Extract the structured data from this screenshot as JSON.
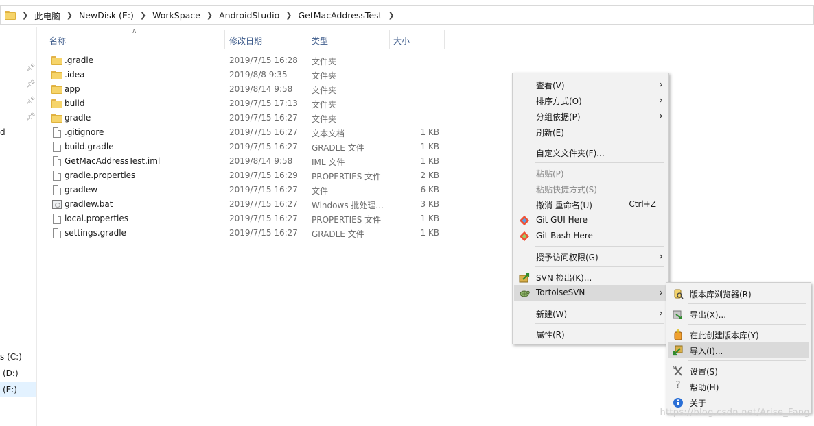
{
  "address_bar": {
    "crumbs": [
      "此电脑",
      "NewDisk (E:)",
      "WorkSpace",
      "AndroidStudio",
      "GetMacAddressTest"
    ]
  },
  "nav": {
    "partial_labels": [
      "d",
      "s (C:)",
      "(D:)",
      "(E:)"
    ]
  },
  "columns": {
    "name": "名称",
    "date": "修改日期",
    "type": "类型",
    "size": "大小"
  },
  "files": [
    {
      "name": ".gradle",
      "date": "2019/7/15 16:28",
      "type": "文件夹",
      "size": "",
      "icon": "folder-icon"
    },
    {
      "name": ".idea",
      "date": "2019/8/8 9:35",
      "type": "文件夹",
      "size": "",
      "icon": "folder-icon"
    },
    {
      "name": "app",
      "date": "2019/8/14 9:58",
      "type": "文件夹",
      "size": "",
      "icon": "folder-icon"
    },
    {
      "name": "build",
      "date": "2019/7/15 17:13",
      "type": "文件夹",
      "size": "",
      "icon": "folder-icon"
    },
    {
      "name": "gradle",
      "date": "2019/7/15 16:27",
      "type": "文件夹",
      "size": "",
      "icon": "folder-icon"
    },
    {
      "name": ".gitignore",
      "date": "2019/7/15 16:27",
      "type": "文本文档",
      "size": "1 KB",
      "icon": "file-icon"
    },
    {
      "name": "build.gradle",
      "date": "2019/7/15 16:27",
      "type": "GRADLE 文件",
      "size": "1 KB",
      "icon": "file-icon"
    },
    {
      "name": "GetMacAddressTest.iml",
      "date": "2019/8/14 9:58",
      "type": "IML 文件",
      "size": "1 KB",
      "icon": "file-icon"
    },
    {
      "name": "gradle.properties",
      "date": "2019/7/15 16:29",
      "type": "PROPERTIES 文件",
      "size": "2 KB",
      "icon": "file-icon"
    },
    {
      "name": "gradlew",
      "date": "2019/7/15 16:27",
      "type": "文件",
      "size": "6 KB",
      "icon": "file-icon"
    },
    {
      "name": "gradlew.bat",
      "date": "2019/7/15 16:27",
      "type": "Windows 批处理...",
      "size": "3 KB",
      "icon": "batch-file-icon"
    },
    {
      "name": "local.properties",
      "date": "2019/7/15 16:27",
      "type": "PROPERTIES 文件",
      "size": "1 KB",
      "icon": "file-icon"
    },
    {
      "name": "settings.gradle",
      "date": "2019/7/15 16:27",
      "type": "GRADLE 文件",
      "size": "1 KB",
      "icon": "file-icon"
    }
  ],
  "context_menu": {
    "items": [
      {
        "label": "查看(V)",
        "submenu": true
      },
      {
        "label": "排序方式(O)",
        "submenu": true
      },
      {
        "label": "分组依据(P)",
        "submenu": true
      },
      {
        "label": "刷新(E)"
      },
      {
        "label": "自定义文件夹(F)..."
      },
      {
        "label": "粘贴(P)",
        "disabled": true
      },
      {
        "label": "粘贴快捷方式(S)",
        "disabled": true
      },
      {
        "label": "撤消 重命名(U)",
        "shortcut": "Ctrl+Z"
      },
      {
        "label": "Git GUI Here",
        "icon": "git-gui-icon"
      },
      {
        "label": "Git Bash Here",
        "icon": "git-bash-icon"
      },
      {
        "label": "授予访问权限(G)",
        "submenu": true
      },
      {
        "label": "SVN 检出(K)...",
        "icon": "svn-checkout-icon"
      },
      {
        "label": "TortoiseSVN",
        "icon": "tortoisesvn-icon",
        "submenu": true,
        "highlighted": true
      },
      {
        "label": "新建(W)",
        "submenu": true
      },
      {
        "label": "属性(R)"
      }
    ]
  },
  "svn_submenu": {
    "items": [
      {
        "label": "版本库浏览器(R)",
        "icon": "repo-browser-icon"
      },
      {
        "label": "导出(X)...",
        "icon": "export-icon"
      },
      {
        "label": "在此创建版本库(Y)",
        "icon": "create-repo-icon"
      },
      {
        "label": "导入(I)...",
        "icon": "import-icon",
        "highlighted": true
      },
      {
        "label": "设置(S)",
        "icon": "settings-icon"
      },
      {
        "label": "帮助(H)",
        "icon": "help-icon"
      },
      {
        "label": "关于",
        "icon": "about-icon"
      }
    ]
  },
  "watermark": "https://blog.csdn.net/Arise_Fang",
  "colors": {
    "selection": "#cce8ff",
    "menu_bg": "#f2f2f2",
    "menu_highlight": "#dadada",
    "folder": "#f6d46a"
  }
}
